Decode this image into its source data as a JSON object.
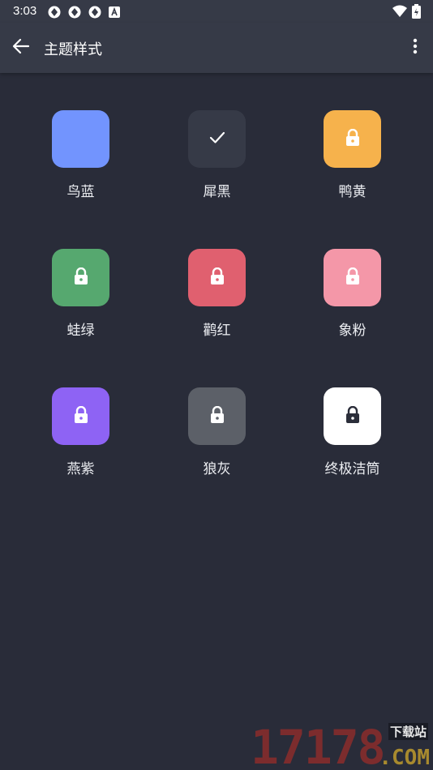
{
  "status_bar": {
    "time": "3:03",
    "icons": [
      "sync-icon",
      "sync-icon",
      "sync-icon",
      "a-icon",
      "wifi-icon",
      "battery-icon"
    ]
  },
  "app_bar": {
    "back_icon": "arrow-left-icon",
    "title": "主题样式",
    "menu_icon": "more-vertical-icon"
  },
  "themes": [
    {
      "label": "鸟蓝",
      "color": "#7294fe",
      "state": "selectable"
    },
    {
      "label": "犀黑",
      "color": "#363a47",
      "state": "selected"
    },
    {
      "label": "鸭黄",
      "color": "#f6b24c",
      "state": "locked"
    },
    {
      "label": "蛙绿",
      "color": "#56a86f",
      "state": "locked"
    },
    {
      "label": "鹳红",
      "color": "#e0606f",
      "state": "locked"
    },
    {
      "label": "象粉",
      "color": "#f497a8",
      "state": "locked"
    },
    {
      "label": "燕紫",
      "color": "#8e63f4",
      "state": "locked"
    },
    {
      "label": "狼灰",
      "color": "#5c6068",
      "state": "locked"
    },
    {
      "label": "终极洁筒",
      "color": "#ffffff",
      "state": "locked"
    }
  ],
  "watermark": {
    "digits": "17178",
    "sub": "下载站",
    "domain": ".COM"
  }
}
